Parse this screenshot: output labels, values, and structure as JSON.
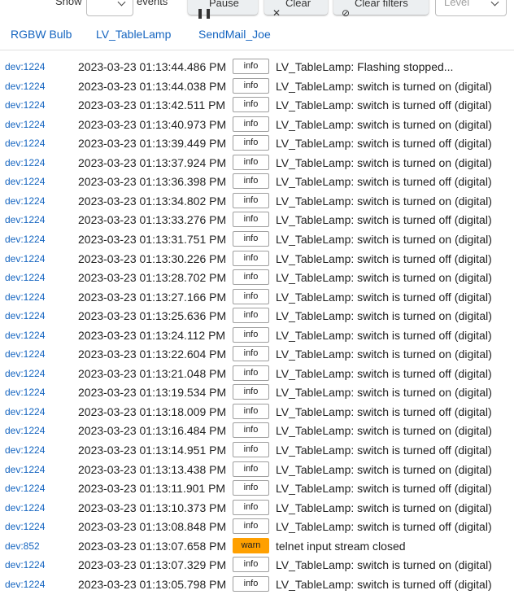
{
  "toolbar": {
    "show_label": "Show",
    "events_label": "events",
    "pause_label": "Pause",
    "clear_label": "Clear",
    "clear_filters_label": "Clear filters",
    "level_placeholder": "Level"
  },
  "tabs": [
    "RGBW Bulb",
    "LV_TableLamp",
    "SendMail_Joe"
  ],
  "colors": {
    "link": "#1565c0",
    "warn": "#ffa000"
  },
  "logs": [
    {
      "dev": "dev:1224",
      "time": "2023-03-23 01:13:44.486 PM",
      "level": "info",
      "msg": "LV_TableLamp: Flashing stopped..."
    },
    {
      "dev": "dev:1224",
      "time": "2023-03-23 01:13:44.038 PM",
      "level": "info",
      "msg": "LV_TableLamp: switch is turned on (digital)"
    },
    {
      "dev": "dev:1224",
      "time": "2023-03-23 01:13:42.511 PM",
      "level": "info",
      "msg": "LV_TableLamp: switch is turned off (digital)"
    },
    {
      "dev": "dev:1224",
      "time": "2023-03-23 01:13:40.973 PM",
      "level": "info",
      "msg": "LV_TableLamp: switch is turned on (digital)"
    },
    {
      "dev": "dev:1224",
      "time": "2023-03-23 01:13:39.449 PM",
      "level": "info",
      "msg": "LV_TableLamp: switch is turned off (digital)"
    },
    {
      "dev": "dev:1224",
      "time": "2023-03-23 01:13:37.924 PM",
      "level": "info",
      "msg": "LV_TableLamp: switch is turned on (digital)"
    },
    {
      "dev": "dev:1224",
      "time": "2023-03-23 01:13:36.398 PM",
      "level": "info",
      "msg": "LV_TableLamp: switch is turned off (digital)"
    },
    {
      "dev": "dev:1224",
      "time": "2023-03-23 01:13:34.802 PM",
      "level": "info",
      "msg": "LV_TableLamp: switch is turned on (digital)"
    },
    {
      "dev": "dev:1224",
      "time": "2023-03-23 01:13:33.276 PM",
      "level": "info",
      "msg": "LV_TableLamp: switch is turned off (digital)"
    },
    {
      "dev": "dev:1224",
      "time": "2023-03-23 01:13:31.751 PM",
      "level": "info",
      "msg": "LV_TableLamp: switch is turned on (digital)"
    },
    {
      "dev": "dev:1224",
      "time": "2023-03-23 01:13:30.226 PM",
      "level": "info",
      "msg": "LV_TableLamp: switch is turned off (digital)"
    },
    {
      "dev": "dev:1224",
      "time": "2023-03-23 01:13:28.702 PM",
      "level": "info",
      "msg": "LV_TableLamp: switch is turned on (digital)"
    },
    {
      "dev": "dev:1224",
      "time": "2023-03-23 01:13:27.166 PM",
      "level": "info",
      "msg": "LV_TableLamp: switch is turned off (digital)"
    },
    {
      "dev": "dev:1224",
      "time": "2023-03-23 01:13:25.636 PM",
      "level": "info",
      "msg": "LV_TableLamp: switch is turned on (digital)"
    },
    {
      "dev": "dev:1224",
      "time": "2023-03-23 01:13:24.112 PM",
      "level": "info",
      "msg": "LV_TableLamp: switch is turned off (digital)"
    },
    {
      "dev": "dev:1224",
      "time": "2023-03-23 01:13:22.604 PM",
      "level": "info",
      "msg": "LV_TableLamp: switch is turned on (digital)"
    },
    {
      "dev": "dev:1224",
      "time": "2023-03-23 01:13:21.048 PM",
      "level": "info",
      "msg": "LV_TableLamp: switch is turned off (digital)"
    },
    {
      "dev": "dev:1224",
      "time": "2023-03-23 01:13:19.534 PM",
      "level": "info",
      "msg": "LV_TableLamp: switch is turned on (digital)"
    },
    {
      "dev": "dev:1224",
      "time": "2023-03-23 01:13:18.009 PM",
      "level": "info",
      "msg": "LV_TableLamp: switch is turned off (digital)"
    },
    {
      "dev": "dev:1224",
      "time": "2023-03-23 01:13:16.484 PM",
      "level": "info",
      "msg": "LV_TableLamp: switch is turned on (digital)"
    },
    {
      "dev": "dev:1224",
      "time": "2023-03-23 01:13:14.951 PM",
      "level": "info",
      "msg": "LV_TableLamp: switch is turned off (digital)"
    },
    {
      "dev": "dev:1224",
      "time": "2023-03-23 01:13:13.438 PM",
      "level": "info",
      "msg": "LV_TableLamp: switch is turned on (digital)"
    },
    {
      "dev": "dev:1224",
      "time": "2023-03-23 01:13:11.901 PM",
      "level": "info",
      "msg": "LV_TableLamp: switch is turned off (digital)"
    },
    {
      "dev": "dev:1224",
      "time": "2023-03-23 01:13:10.373 PM",
      "level": "info",
      "msg": "LV_TableLamp: switch is turned on (digital)"
    },
    {
      "dev": "dev:1224",
      "time": "2023-03-23 01:13:08.848 PM",
      "level": "info",
      "msg": "LV_TableLamp: switch is turned off (digital)"
    },
    {
      "dev": "dev:852",
      "time": "2023-03-23 01:13:07.658 PM",
      "level": "warn",
      "msg": "telnet input stream closed"
    },
    {
      "dev": "dev:1224",
      "time": "2023-03-23 01:13:07.329 PM",
      "level": "info",
      "msg": "LV_TableLamp: switch is turned on (digital)"
    },
    {
      "dev": "dev:1224",
      "time": "2023-03-23 01:13:05.798 PM",
      "level": "info",
      "msg": "LV_TableLamp: switch is turned off (digital)"
    }
  ]
}
